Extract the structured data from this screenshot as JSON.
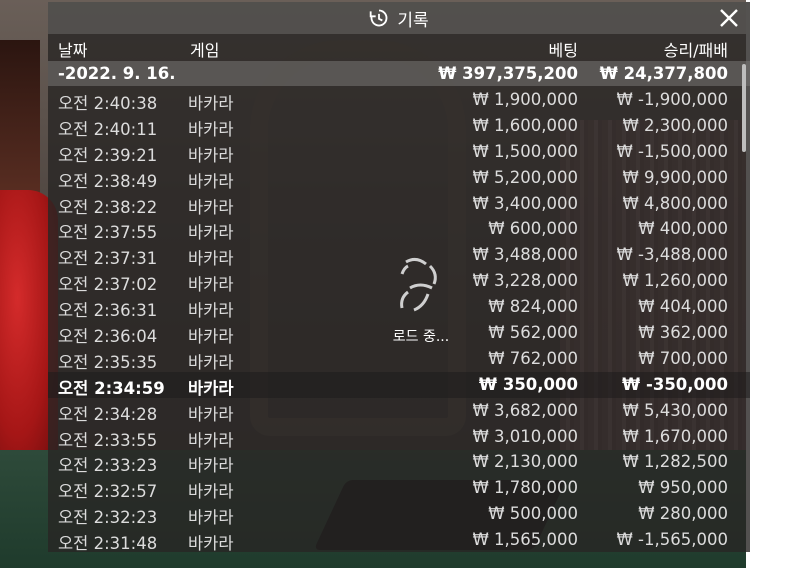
{
  "window": {
    "title": "기록",
    "icon": "history-icon",
    "close_icon": "close-icon"
  },
  "columns": {
    "date": "날짜",
    "game": "게임",
    "bet": "베팅",
    "win_loss": "승리/패배"
  },
  "summary": {
    "date": "-2022. 9. 16.",
    "game": "",
    "bet": "₩ 397,375,200",
    "win_loss": "₩ 24,377,800"
  },
  "rows": [
    {
      "date": "오전 2:40:38",
      "game": "바카라",
      "bet": "₩ 1,900,000",
      "win_loss": "₩ -1,900,000"
    },
    {
      "date": "오전 2:40:11",
      "game": "바카라",
      "bet": "₩ 1,600,000",
      "win_loss": "₩ 2,300,000"
    },
    {
      "date": "오전 2:39:21",
      "game": "바카라",
      "bet": "₩ 1,500,000",
      "win_loss": "₩ -1,500,000"
    },
    {
      "date": "오전 2:38:49",
      "game": "바카라",
      "bet": "₩ 5,200,000",
      "win_loss": "₩ 9,900,000"
    },
    {
      "date": "오전 2:38:22",
      "game": "바카라",
      "bet": "₩ 3,400,000",
      "win_loss": "₩ 4,800,000"
    },
    {
      "date": "오전 2:37:55",
      "game": "바카라",
      "bet": "₩ 600,000",
      "win_loss": "₩ 400,000"
    },
    {
      "date": "오전 2:37:31",
      "game": "바카라",
      "bet": "₩ 3,488,000",
      "win_loss": "₩ -3,488,000"
    },
    {
      "date": "오전 2:37:02",
      "game": "바카라",
      "bet": "₩ 3,228,000",
      "win_loss": "₩ 1,260,000"
    },
    {
      "date": "오전 2:36:31",
      "game": "바카라",
      "bet": "₩ 824,000",
      "win_loss": "₩ 404,000"
    },
    {
      "date": "오전 2:36:04",
      "game": "바카라",
      "bet": "₩ 562,000",
      "win_loss": "₩ 362,000"
    },
    {
      "date": "오전 2:35:35",
      "game": "바카라",
      "bet": "₩ 762,000",
      "win_loss": "₩ 700,000"
    },
    {
      "date": "오전 2:34:59",
      "game": "바카라",
      "bet": "₩ 350,000",
      "win_loss": "₩ -350,000"
    },
    {
      "date": "오전 2:34:28",
      "game": "바카라",
      "bet": "₩ 3,682,000",
      "win_loss": "₩ 5,430,000"
    },
    {
      "date": "오전 2:33:55",
      "game": "바카라",
      "bet": "₩ 3,010,000",
      "win_loss": "₩ 1,670,000"
    },
    {
      "date": "오전 2:33:23",
      "game": "바카라",
      "bet": "₩ 2,130,000",
      "win_loss": "₩ 1,282,500"
    },
    {
      "date": "오전 2:32:57",
      "game": "바카라",
      "bet": "₩ 1,780,000",
      "win_loss": "₩ 950,000"
    },
    {
      "date": "오전 2:32:23",
      "game": "바카라",
      "bet": "₩ 500,000",
      "win_loss": "₩ 280,000"
    },
    {
      "date": "오전 2:31:48",
      "game": "바카라",
      "bet": "₩ 1,565,000",
      "win_loss": "₩ -1,565,000"
    }
  ],
  "loader": {
    "text": "로드 중...",
    "icon": "spinner-icon"
  }
}
